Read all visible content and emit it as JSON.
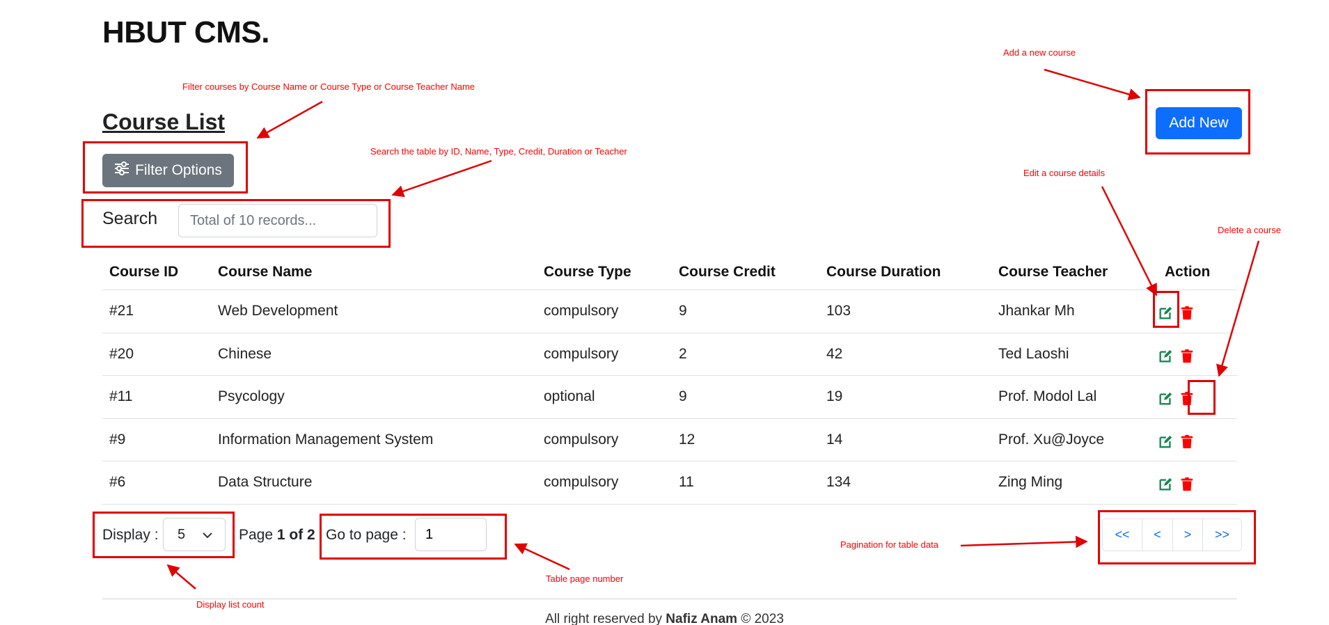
{
  "brand": "HBUT CMS.",
  "page_title": "Course List",
  "filter_button": "Filter Options",
  "add_button": "Add New",
  "search": {
    "label": "Search",
    "placeholder": "Total of 10 records..."
  },
  "table": {
    "headers": [
      "Course ID",
      "Course Name",
      "Course Type",
      "Course Credit",
      "Course Duration",
      "Course Teacher",
      "Action"
    ],
    "rows": [
      [
        "#21",
        "Web Development",
        "compulsory",
        "9",
        "103",
        "Jhankar Mh"
      ],
      [
        "#20",
        "Chinese",
        "compulsory",
        "2",
        "42",
        "Ted Laoshi"
      ],
      [
        "#11",
        "Psycology",
        "optional",
        "9",
        "19",
        "Prof. Modol Lal"
      ],
      [
        "#9",
        "Information Management System",
        "compulsory",
        "12",
        "14",
        "Prof. Xu@Joyce"
      ],
      [
        "#6",
        "Data Structure",
        "compulsory",
        "11",
        "134",
        "Zing Ming"
      ]
    ]
  },
  "pagination": {
    "display_label": "Display :",
    "display_value": "5",
    "page_prefix": "Page ",
    "page_current": "1 of 2",
    "goto_label": "Go to page :",
    "goto_value": "1",
    "buttons": [
      "<<",
      "<",
      ">",
      ">>"
    ]
  },
  "footer": {
    "prefix": "All right reserved by ",
    "author": "Nafiz Anam",
    "suffix": " © 2023"
  },
  "annotations": {
    "filter": "Filter courses by Course Name or Course Type or Course Teacher Name",
    "search": "Search the table by ID, Name, Type, Credit, Duration or Teacher",
    "add": "Add a new course",
    "edit": "Edit a course details",
    "delete": "Delete a course",
    "pagination": "Pagination for table data",
    "page_number": "Table page number",
    "display_count": "Display list count"
  },
  "colors": {
    "primary": "#0d6efd",
    "secondary": "#6c757d",
    "edit": "#198754",
    "delete": "#ff0000",
    "annotation": "#ff0000"
  }
}
